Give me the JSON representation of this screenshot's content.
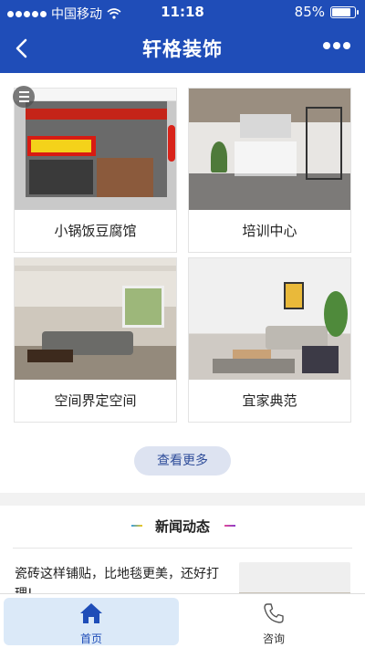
{
  "status_bar": {
    "carrier": "中国移动",
    "time": "11:18",
    "battery": "85%",
    "battery_level": 0.85
  },
  "nav": {
    "title": "轩格装饰"
  },
  "cases": [
    {
      "label": "小锅饭豆腐馆"
    },
    {
      "label": "培训中心"
    },
    {
      "label": "空间界定空间"
    },
    {
      "label": "宜家典范"
    }
  ],
  "more_button": "查看更多",
  "news": {
    "title": "新闻动态",
    "item_text": "瓷砖这样铺贴，比地毯更美，还好打理!"
  },
  "tabbar": {
    "home": "首页",
    "consult": "咨询"
  },
  "colors": {
    "brand_blue": "#1f4db8",
    "button_bg": "#dde3f1",
    "tab_active_bg": "#dbe9f8"
  },
  "icons": {
    "back": "chevron-left-icon",
    "more": "more-dots-icon",
    "grid": "list-icon",
    "home": "home-icon",
    "consult": "phone-icon",
    "wifi": "wifi-icon",
    "battery": "battery-icon"
  }
}
